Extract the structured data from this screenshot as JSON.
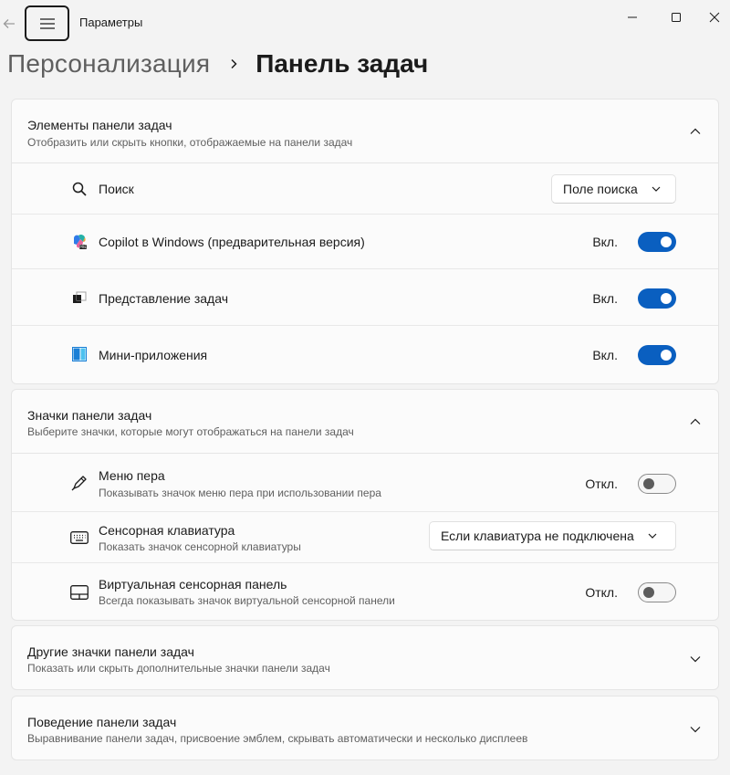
{
  "window": {
    "app_title": "Параметры"
  },
  "breadcrumb": {
    "parent": "Персонализация",
    "current": "Панель задач"
  },
  "sections": {
    "taskbar_items": {
      "title": "Элементы панели задач",
      "subtitle": "Отобразить или скрыть кнопки, отображаемые на панели задач",
      "search": {
        "label": "Поиск",
        "value": "Поле поиска"
      },
      "copilot": {
        "label": "Copilot в Windows (предварительная версия)",
        "state": "Вкл.",
        "on": true
      },
      "task_view": {
        "label": "Представление задач",
        "state": "Вкл.",
        "on": true
      },
      "widgets": {
        "label": "Мини-приложения",
        "state": "Вкл.",
        "on": true
      }
    },
    "taskbar_icons": {
      "title": "Значки панели задач",
      "subtitle": "Выберите значки, которые могут отображаться на панели задач",
      "pen_menu": {
        "label": "Меню пера",
        "sub": "Показывать значок меню пера при использовании пера",
        "state": "Откл.",
        "on": false
      },
      "touch_keyboard": {
        "label": "Сенсорная клавиатура",
        "sub": "Показать значок сенсорной клавиатуры",
        "value": "Если клавиатура не подключена"
      },
      "virtual_touchpad": {
        "label": "Виртуальная сенсорная панель",
        "sub": "Всегда показывать значок виртуальной сенсорной панели",
        "state": "Откл.",
        "on": false
      }
    },
    "other_icons": {
      "title": "Другие значки панели задач",
      "subtitle": "Показать или скрыть дополнительные значки панели задач"
    },
    "behavior": {
      "title": "Поведение панели задач",
      "subtitle": "Выравнивание панели задач, присвоение эмблем, скрывать автоматически и несколько дисплеев"
    }
  },
  "colors": {
    "accent": "#0a5fc0",
    "background": "#f3f3f3",
    "card": "#fbfbfb"
  },
  "icons": {
    "back": "arrow-left-icon",
    "menu": "hamburger-icon",
    "search": "search-icon",
    "copilot": "copilot-icon",
    "task_view": "task-view-icon",
    "widgets": "widgets-icon",
    "pen": "pen-icon",
    "keyboard": "keyboard-icon",
    "touchpad": "touchpad-icon"
  }
}
